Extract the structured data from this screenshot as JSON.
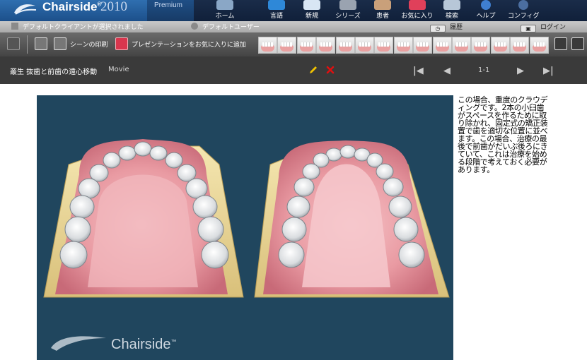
{
  "app": {
    "name": "Chairside",
    "trademark": "®",
    "year": "2010",
    "edition": "Premium"
  },
  "nav": [
    {
      "id": "home",
      "label": "ホーム",
      "icon": "house-icon"
    },
    {
      "id": "language",
      "label": "言語",
      "icon": "globe-icon"
    },
    {
      "id": "new",
      "label": "新規",
      "icon": "new-document-icon"
    },
    {
      "id": "series",
      "label": "シリーズ",
      "icon": "film-reel-icon"
    },
    {
      "id": "patient",
      "label": "患者",
      "icon": "patient-icon"
    },
    {
      "id": "favorites",
      "label": "お気に入り",
      "icon": "heart-icon"
    },
    {
      "id": "search",
      "label": "検索",
      "icon": "magnifier-icon"
    },
    {
      "id": "help",
      "label": "ヘルプ",
      "icon": "help-icon"
    },
    {
      "id": "config",
      "label": "コンフィグ",
      "icon": "gear-icon"
    }
  ],
  "status": {
    "client": "デフォルトクライアントが選択されました",
    "user": "デフォルトユーザー",
    "history": "履歴",
    "login": "ログイン"
  },
  "toolbar": {
    "print_scene": "シーンの印刷",
    "add_to_favorites": "プレゼンテーションをお気に入りに追加",
    "thumbnail_count": 15
  },
  "scene": {
    "title": "叢生 抜歯と前歯の遠心移動",
    "type": "Movie",
    "page": "1-1"
  },
  "watermark": {
    "text": "Chairside",
    "tm": "™"
  },
  "description": "この場合、重度のクラウディングです。2本の小臼歯がスペースを作るために取り除かれ、固定式の矯正装置で歯を適切な位置に並べます。この場合、治療の最後で前歯がだいぶ後ろにきていて、これは治療を始める段階で考えておく必要があります。",
  "colors": {
    "viewer_bg": "#20465e",
    "edit_pencil": "#f2c300",
    "delete_x": "#e01010",
    "gum": "#e99aa2"
  }
}
